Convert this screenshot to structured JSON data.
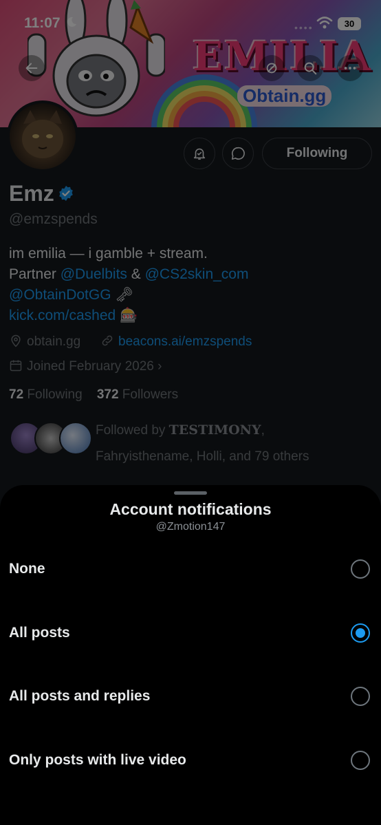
{
  "status_bar": {
    "time": "11:07",
    "battery": "30"
  },
  "banner": {
    "art_title": "EMILIA",
    "art_subtitle": "Obtain.gg"
  },
  "profile": {
    "name": "Emz",
    "handle": "@emzspends",
    "following_button": "Following",
    "bio_line1": "im emilia — i gamble + stream.",
    "bio_partner": "Partner",
    "bio_mention1": "@Duelbits",
    "bio_amp": "&",
    "bio_mention2": "@CS2skin_com",
    "bio_mention3": "@ObtainDotGG",
    "bio_emoji1": "🗝",
    "bio_link": "kick.com/cashed",
    "bio_emoji2": "🎰",
    "location": "obtain.gg",
    "website": "beacons.ai/emzspends",
    "joined": "Joined February 2026",
    "following_count": "72",
    "following_label": "Following",
    "followers_count": "372",
    "followers_label": "Followers",
    "followed_by_prefix": "Followed by",
    "followed_by_highlight": "TESTIMONY",
    "followed_by_rest": "Fahryisthename, Holli, and 79 others"
  },
  "sheet": {
    "title": "Account notifications",
    "subtitle": "@Zmotion147",
    "options": [
      {
        "label": "None",
        "selected": false
      },
      {
        "label": "All posts",
        "selected": true
      },
      {
        "label": "All posts and replies",
        "selected": false
      },
      {
        "label": "Only posts with live video",
        "selected": false
      }
    ]
  },
  "colors": {
    "accent": "#1d9bf0",
    "sheet_bg": "#000000",
    "profile_bg": "#15181c"
  }
}
